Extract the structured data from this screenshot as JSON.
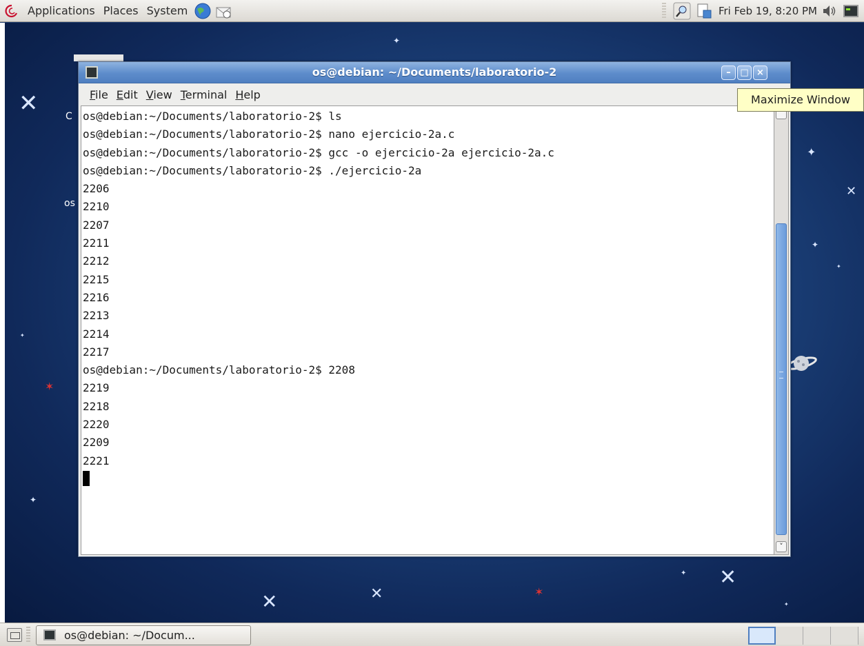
{
  "top_panel": {
    "menus": [
      "Applications",
      "Places",
      "System"
    ],
    "clock": "Fri Feb 19,  8:20 PM"
  },
  "window": {
    "title": "os@debian: ~/Documents/laboratorio-2",
    "menu": [
      "File",
      "Edit",
      "View",
      "Terminal",
      "Help"
    ],
    "menu_mnemonics": [
      "F",
      "E",
      "V",
      "T",
      "H"
    ]
  },
  "terminal": {
    "lines": [
      "os@debian:~/Documents/laboratorio-2$ ls",
      "os@debian:~/Documents/laboratorio-2$ nano ejercicio-2a.c",
      "os@debian:~/Documents/laboratorio-2$ gcc -o ejercicio-2a ejercicio-2a.c",
      "os@debian:~/Documents/laboratorio-2$ ./ejercicio-2a",
      "2206",
      "2210",
      "2207",
      "2211",
      "2212",
      "2215",
      "2216",
      "2213",
      "2214",
      "2217",
      "os@debian:~/Documents/laboratorio-2$ 2208",
      "2219",
      "2218",
      "2220",
      "2209",
      "2221"
    ]
  },
  "tooltip": "Maximize Window",
  "taskbar": {
    "window_button": "os@debian: ~/Docum..."
  },
  "desktop_fragments": {
    "label_c": "C",
    "label_os": "os"
  },
  "colors": {
    "titlebar": "#5d8ccb",
    "scroll_thumb": "#6b9bdb",
    "tooltip_bg": "#ffffc6"
  }
}
